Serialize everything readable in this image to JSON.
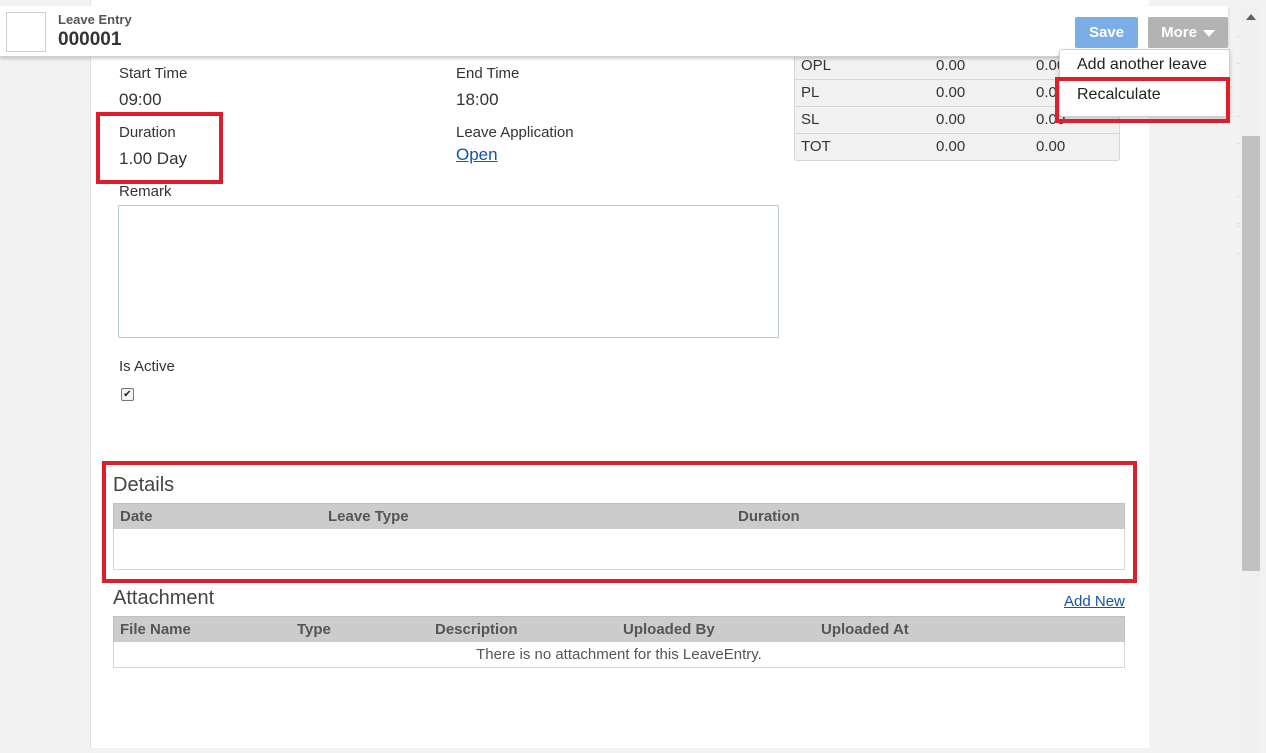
{
  "header": {
    "doc_type": "Leave Entry",
    "doc_number": "000001",
    "save_label": "Save",
    "more_label": "More"
  },
  "menu": {
    "items": [
      {
        "label": "Add another leave"
      },
      {
        "label": "Recalculate"
      }
    ]
  },
  "form": {
    "start_time_label": "Start Time",
    "start_time_value": "09:00",
    "end_time_label": "End Time",
    "end_time_value": "18:00",
    "duration_label": "Duration",
    "duration_value": "1.00 Day",
    "leave_application_label": "Leave Application",
    "leave_application_link": "Open",
    "remark_label": "Remark",
    "remark_value": "",
    "is_active_label": "Is Active",
    "is_active_checked": true
  },
  "balance": {
    "rows": [
      {
        "type": "OPL",
        "col1": "0.00",
        "col2": "0.00"
      },
      {
        "type": "PL",
        "col1": "0.00",
        "col2": "0.00"
      },
      {
        "type": "SL",
        "col1": "0.00",
        "col2": "0.00"
      },
      {
        "type": "TOT",
        "col1": "0.00",
        "col2": "0.00"
      }
    ]
  },
  "details": {
    "title": "Details",
    "columns": [
      "Date",
      "Leave Type",
      "Duration"
    ]
  },
  "attachment": {
    "title": "Attachment",
    "add_new": "Add New",
    "columns": [
      "File Name",
      "Type",
      "Description",
      "Uploaded By",
      "Uploaded At"
    ],
    "empty_message": "There is no attachment for this LeaveEntry."
  },
  "colors": {
    "highlight": "#e01e2b",
    "save_button": "#7baee6",
    "more_button": "#b3b3b3",
    "link": "#1155aa"
  }
}
